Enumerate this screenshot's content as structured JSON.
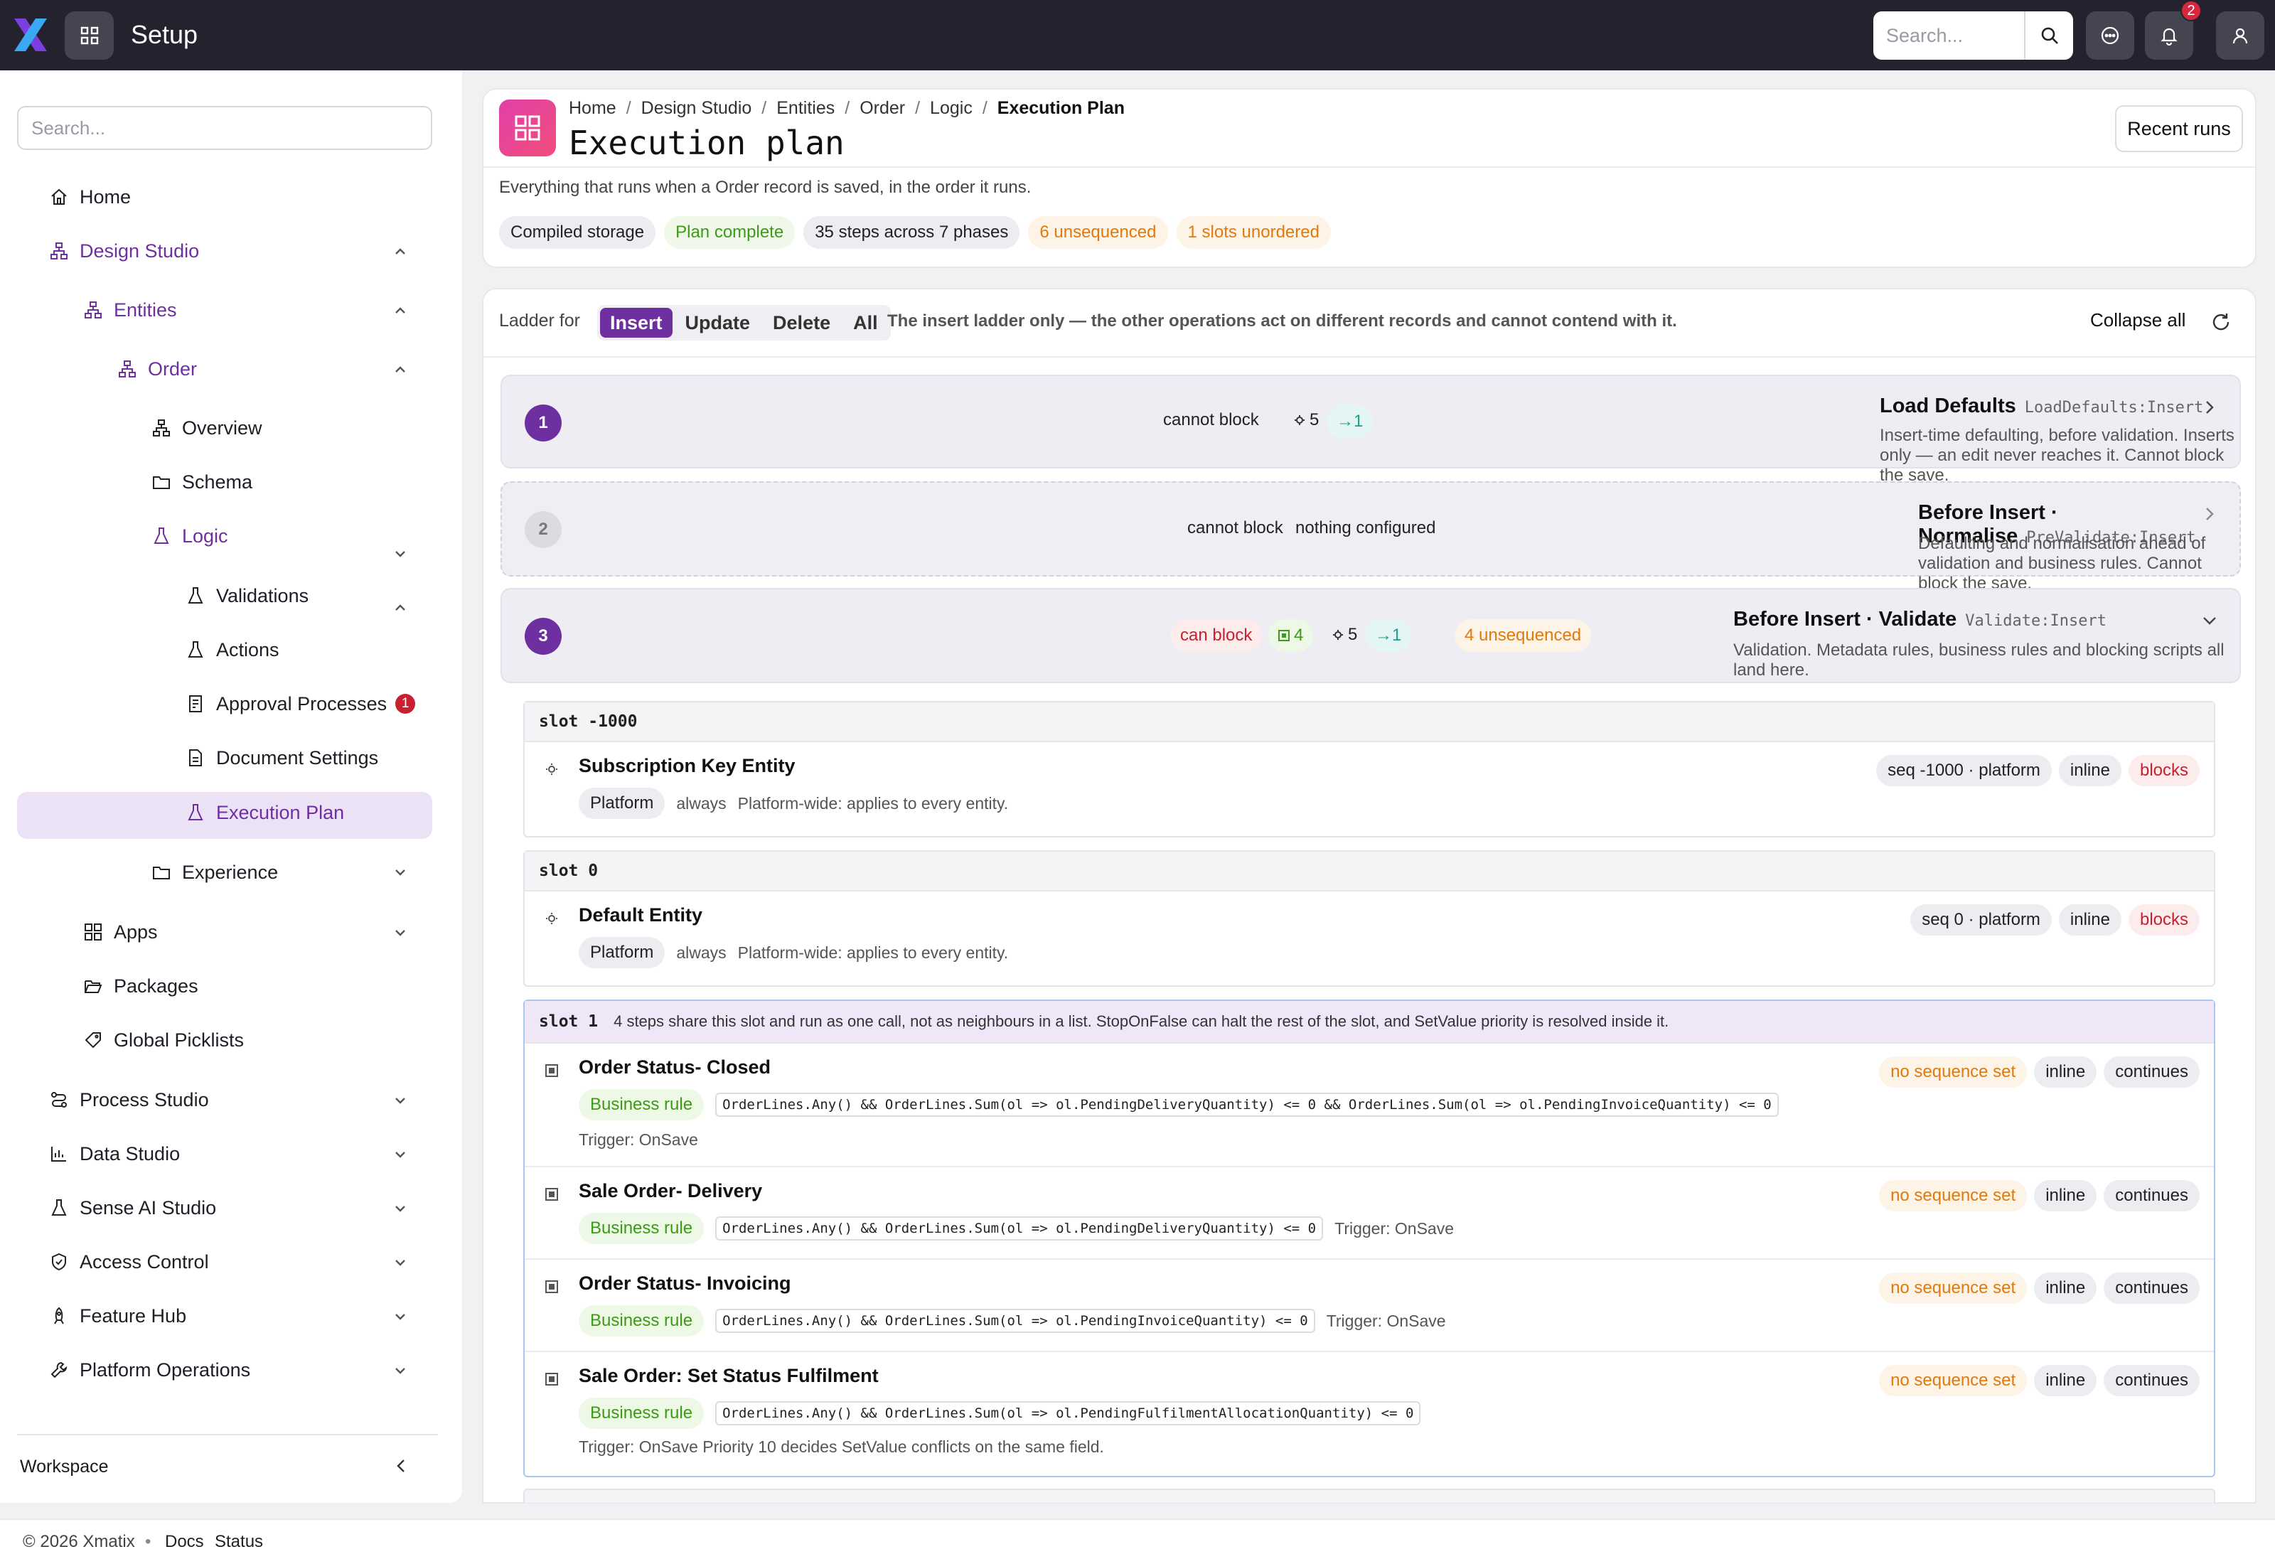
{
  "app": {
    "title": "Setup",
    "search_placeholder": "Search...",
    "notification_count": "2"
  },
  "sidebar": {
    "search_placeholder": "Search...",
    "items": [
      {
        "label": "Home"
      },
      {
        "label": "Design Studio"
      },
      {
        "label": "Entities"
      },
      {
        "label": "Order"
      },
      {
        "label": "Overview"
      },
      {
        "label": "Schema"
      },
      {
        "label": "Logic"
      },
      {
        "label": "Validations"
      },
      {
        "label": "Actions"
      },
      {
        "label": "Approval Processes",
        "badge": "1"
      },
      {
        "label": "Document Settings"
      },
      {
        "label": "Execution Plan"
      },
      {
        "label": "Experience"
      },
      {
        "label": "Apps"
      },
      {
        "label": "Packages"
      },
      {
        "label": "Global Picklists"
      },
      {
        "label": "Process Studio"
      },
      {
        "label": "Data Studio"
      },
      {
        "label": "Sense AI Studio"
      },
      {
        "label": "Access Control"
      },
      {
        "label": "Feature Hub"
      },
      {
        "label": "Platform Operations"
      }
    ],
    "workspace_label": "Workspace"
  },
  "header": {
    "breadcrumb": [
      "Home",
      "Design Studio",
      "Entities",
      "Order",
      "Logic",
      "Execution Plan"
    ],
    "title": "Execution plan",
    "recent_runs_label": "Recent runs",
    "description": "Everything that runs when a Order record is saved, in the order it runs.",
    "chips": [
      "Compiled storage",
      "Plan complete",
      "35 steps across 7 phases",
      "6 unsequenced",
      "1 slots unordered"
    ]
  },
  "ladder": {
    "label": "Ladder for",
    "tabs": [
      "Insert",
      "Update",
      "Delete",
      "All"
    ],
    "active_tab": "Insert",
    "note": "The insert ladder only — the other operations act on different records and cannot contend with it.",
    "collapse_all_label": "Collapse all"
  },
  "phases": [
    {
      "num": "1",
      "block": "cannot block",
      "gears": "5",
      "arrow": "→1",
      "title": "Load Defaults",
      "code": "LoadDefaults:Insert",
      "desc": "Insert-time defaulting, before validation. Inserts only — an edit never reaches it. Cannot block the save."
    },
    {
      "num": "2",
      "block": "cannot block",
      "config": "nothing configured",
      "title": "Before Insert · Normalise",
      "code": "PreValidate:Insert",
      "desc": "Defaulting and normalisation ahead of validation and business rules. Cannot block the save."
    },
    {
      "num": "3",
      "block": "can block",
      "rules": "4",
      "gears": "5",
      "arrow": "→1",
      "unsequenced": "4 unsequenced",
      "title": "Before Insert · Validate",
      "code": "Validate:Insert",
      "desc": "Validation. Metadata rules, business rules and blocking scripts all land here."
    }
  ],
  "slots": [
    {
      "label": "slot -1000",
      "steps": [
        {
          "name": "Subscription Key Entity",
          "type": "Platform",
          "cond": "always",
          "desc": "Platform-wide: applies to every entity.",
          "tags": [
            "seq -1000 · platform",
            "inline",
            "blocks"
          ]
        }
      ]
    },
    {
      "label": "slot 0",
      "steps": [
        {
          "name": "Default Entity",
          "type": "Platform",
          "cond": "always",
          "desc": "Platform-wide: applies to every entity.",
          "tags": [
            "seq 0 · platform",
            "inline",
            "blocks"
          ]
        }
      ]
    },
    {
      "label": "slot 1",
      "note": "4 steps share this slot and run as one call, not as neighbours in a list. StopOnFalse can halt the rest of the slot, and SetValue priority is resolved inside it.",
      "steps": [
        {
          "name": "Order Status- Closed",
          "type": "Business rule",
          "expr": "OrderLines.Any() && OrderLines.Sum(ol => ol.PendingDeliveryQuantity) <= 0 && OrderLines.Sum(ol => ol.PendingInvoiceQuantity) <= 0",
          "trigger": "Trigger: OnSave",
          "tags": [
            "no sequence set",
            "inline",
            "continues"
          ]
        },
        {
          "name": "Sale Order- Delivery",
          "type": "Business rule",
          "expr": "OrderLines.Any() && OrderLines.Sum(ol => ol.PendingDeliveryQuantity) <= 0",
          "trigger": "Trigger: OnSave",
          "tags": [
            "no sequence set",
            "inline",
            "continues"
          ]
        },
        {
          "name": "Order Status- Invoicing",
          "type": "Business rule",
          "expr": "OrderLines.Any() && OrderLines.Sum(ol => ol.PendingInvoiceQuantity) <= 0",
          "trigger": "Trigger: OnSave",
          "tags": [
            "no sequence set",
            "inline",
            "continues"
          ]
        },
        {
          "name": "Sale Order: Set Status Fulfilment",
          "type": "Business rule",
          "expr": "OrderLines.Any() && OrderLines.Sum(ol => ol.PendingFulfilmentAllocationQuantity) <= 0",
          "trigger": "Trigger: OnSave Priority 10 decides SetValue conflicts on the same field.",
          "tags": [
            "no sequence set",
            "inline",
            "continues"
          ]
        }
      ]
    }
  ],
  "footer": {
    "copyright": "© 2026 Xmatix",
    "links": [
      "Docs",
      "Status"
    ]
  },
  "colors": {
    "accent": "#6e2fa0",
    "topbar": "#23222e",
    "green": "#3d9a16",
    "orange": "#e07a0f",
    "red": "#c8202f",
    "teal": "#1f9e8e"
  }
}
